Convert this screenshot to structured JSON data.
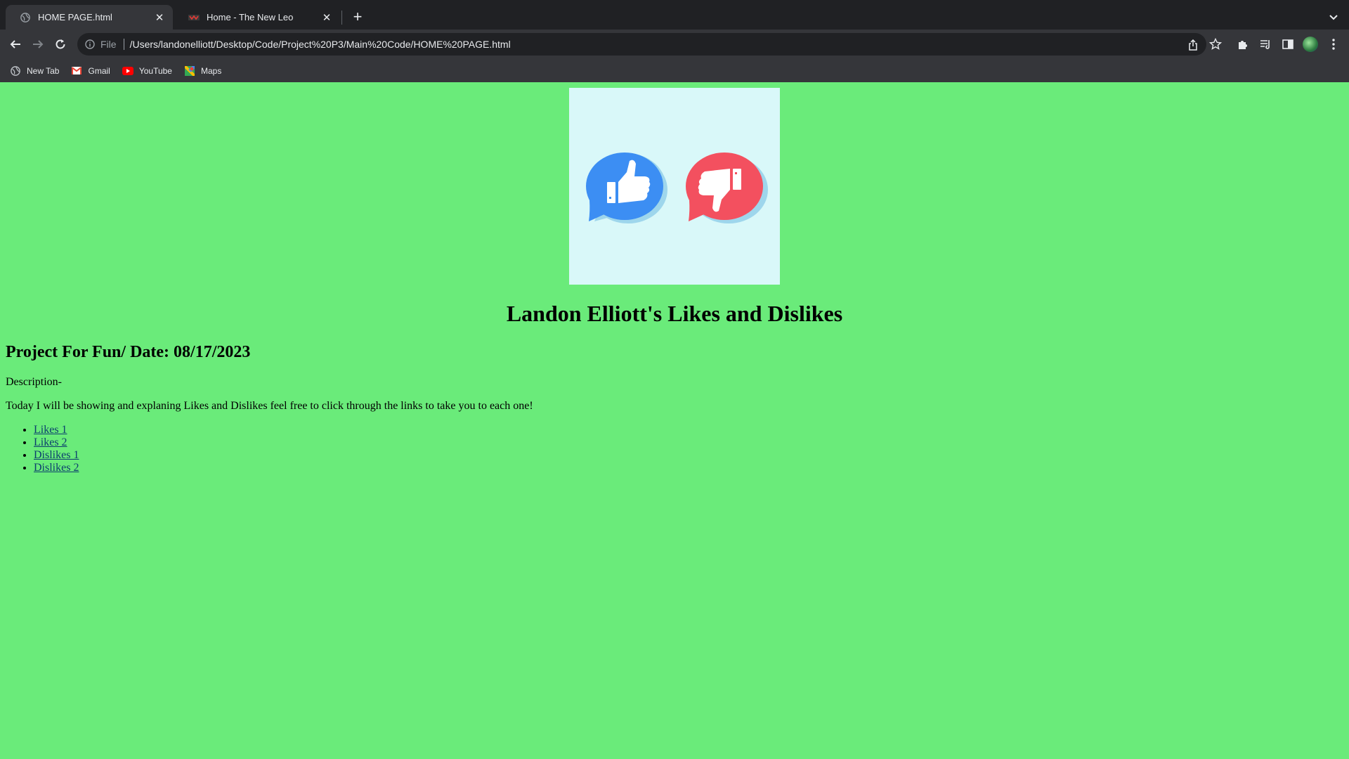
{
  "browser": {
    "tabs": [
      {
        "title": "HOME PAGE.html",
        "active": true
      },
      {
        "title": "Home - The New Leo",
        "active": false
      }
    ],
    "omnibox": {
      "scheme": "File",
      "url": "/Users/landonelliott/Desktop/Code/Project%20P3/Main%20Code/HOME%20PAGE.html"
    },
    "bookmarks": [
      {
        "label": "New Tab",
        "icon": "globe-icon"
      },
      {
        "label": "Gmail",
        "icon": "gmail-icon"
      },
      {
        "label": "YouTube",
        "icon": "youtube-icon"
      },
      {
        "label": "Maps",
        "icon": "maps-icon"
      }
    ]
  },
  "page": {
    "background": "#6aeb7a",
    "hero": {
      "background": "#d9f8f9",
      "like_color": "#3c8ef3",
      "dislike_color": "#f3505f"
    },
    "title": "Landon Elliott's Likes and Dislikes",
    "subtitle": "Project For Fun/ Date: 08/17/2023",
    "description_label": "Description-",
    "description": "Today I will be showing and explaning Likes and Dislikes feel free to click through the links to take you to each one!",
    "links": [
      "Likes 1",
      "Likes 2",
      "Dislikes 1",
      "Dislikes 2"
    ]
  }
}
